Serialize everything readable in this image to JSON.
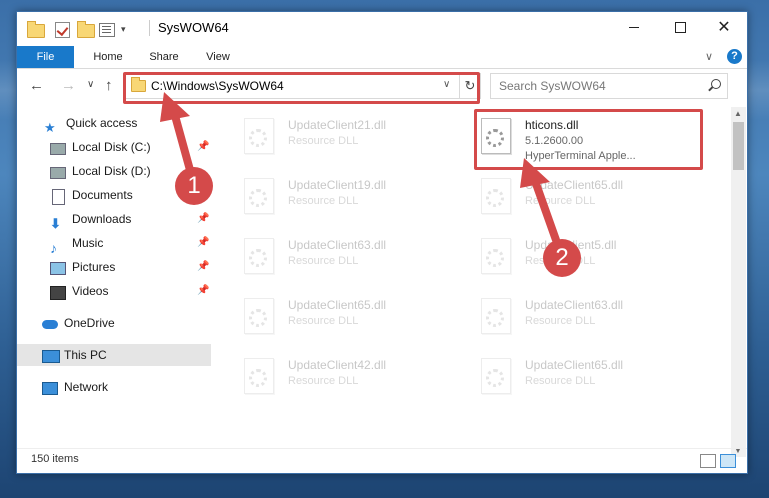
{
  "window": {
    "title": "SysWOW64",
    "controls": {
      "minimize": "",
      "maximize": "",
      "close": "✕"
    }
  },
  "ribbon": {
    "tabs": [
      {
        "label": "File"
      },
      {
        "label": "Home"
      },
      {
        "label": "Share"
      },
      {
        "label": "View"
      }
    ],
    "help": "?"
  },
  "nav": {
    "address": "C:\\Windows\\SysWOW64",
    "search_placeholder": "Search SysWOW64"
  },
  "sidebar": {
    "items": [
      {
        "label": "Quick access"
      },
      {
        "label": "Local Disk (C:)"
      },
      {
        "label": "Local Disk (D:)"
      },
      {
        "label": "Documents"
      },
      {
        "label": "Downloads"
      },
      {
        "label": "Music"
      },
      {
        "label": "Pictures"
      },
      {
        "label": "Videos"
      },
      {
        "label": "OneDrive"
      },
      {
        "label": "This PC"
      },
      {
        "label": "Network"
      }
    ]
  },
  "files": {
    "left": [
      {
        "name": "UpdateClient21.dll",
        "type": "Resource DLL"
      },
      {
        "name": "UpdateClient19.dll",
        "type": "Resource DLL"
      },
      {
        "name": "UpdateClient63.dll",
        "type": "Resource DLL"
      },
      {
        "name": "UpdateClient65.dll",
        "type": "Resource DLL"
      },
      {
        "name": "UpdateClient42.dll",
        "type": "Resource DLL"
      }
    ],
    "right": [
      {
        "name": "UpdateClient65.dll",
        "type": "Resource DLL"
      },
      {
        "name": "UpdateClient5.dll",
        "type": "Resource DLL"
      },
      {
        "name": "UpdateClient63.dll",
        "type": "Resource DLL"
      },
      {
        "name": "UpdateClient65.dll",
        "type": "Resource DLL"
      }
    ],
    "highlighted": {
      "name": "hticons.dll",
      "version": "5.1.2600.00",
      "description": "HyperTerminal Apple..."
    }
  },
  "status": {
    "items": "150 items"
  },
  "annotations": {
    "badge1": "1",
    "badge2": "2"
  },
  "colors": {
    "annotation": "#d44a4a",
    "accent": "#1979ca"
  }
}
